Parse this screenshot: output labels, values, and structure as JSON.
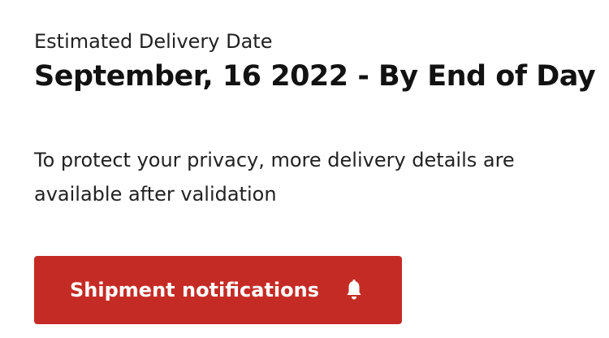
{
  "delivery": {
    "label": "Estimated Delivery Date",
    "date": "September, 16 2022 - By End of Day",
    "privacy_note": "To protect your privacy, more delivery details are available after validation"
  },
  "notifications_button": {
    "label": "Shipment notifications",
    "icon": "bell-icon",
    "color": "#c52b25"
  }
}
